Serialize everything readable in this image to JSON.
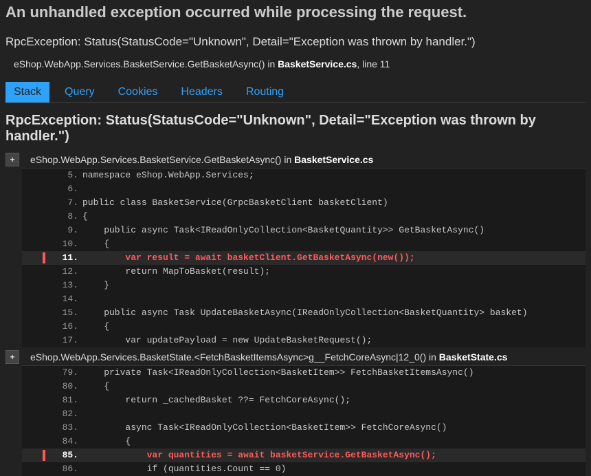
{
  "heading": "An unhandled exception occurred while processing the request.",
  "exception_summary": "RpcException: Status(StatusCode=\"Unknown\", Detail=\"Exception was thrown by handler.\")",
  "origin": {
    "prefix": "eShop.WebApp.Services.BasketService.GetBasketAsync() in ",
    "file": "BasketService.cs",
    "suffix": ", line 11"
  },
  "tabs": [
    {
      "label": "Stack",
      "active": true
    },
    {
      "label": "Query",
      "active": false
    },
    {
      "label": "Cookies",
      "active": false
    },
    {
      "label": "Headers",
      "active": false
    },
    {
      "label": "Routing",
      "active": false
    }
  ],
  "stack_heading": "RpcException: Status(StatusCode=\"Unknown\", Detail=\"Exception was thrown by handler.\")",
  "frames": [
    {
      "expand": "+",
      "prefix": "eShop.WebApp.Services.BasketService.GetBasketAsync() in ",
      "file": "BasketService.cs",
      "suffix": "",
      "lines": [
        {
          "n": "5",
          "hl": false,
          "code": "namespace eShop.WebApp.Services;"
        },
        {
          "n": "6",
          "hl": false,
          "code": ""
        },
        {
          "n": "7",
          "hl": false,
          "code": "public class BasketService(GrpcBasketClient basketClient)"
        },
        {
          "n": "8",
          "hl": false,
          "code": "{"
        },
        {
          "n": "9",
          "hl": false,
          "code": "    public async Task<IReadOnlyCollection<BasketQuantity>> GetBasketAsync()"
        },
        {
          "n": "10",
          "hl": false,
          "code": "    {"
        },
        {
          "n": "11",
          "hl": true,
          "code": "        var result = await basketClient.GetBasketAsync(new());"
        },
        {
          "n": "12",
          "hl": false,
          "code": "        return MapToBasket(result);"
        },
        {
          "n": "13",
          "hl": false,
          "code": "    }"
        },
        {
          "n": "14",
          "hl": false,
          "code": ""
        },
        {
          "n": "15",
          "hl": false,
          "code": "    public async Task UpdateBasketAsync(IReadOnlyCollection<BasketQuantity> basket)"
        },
        {
          "n": "16",
          "hl": false,
          "code": "    {"
        },
        {
          "n": "17",
          "hl": false,
          "code": "        var updatePayload = new UpdateBasketRequest();"
        }
      ]
    },
    {
      "expand": "+",
      "prefix": "eShop.WebApp.Services.BasketState.<FetchBasketItemsAsync>g__FetchCoreAsync|12_0() in ",
      "file": "BasketState.cs",
      "suffix": "",
      "lines": [
        {
          "n": "79",
          "hl": false,
          "code": "    private Task<IReadOnlyCollection<BasketItem>> FetchBasketItemsAsync()"
        },
        {
          "n": "80",
          "hl": false,
          "code": "    {"
        },
        {
          "n": "81",
          "hl": false,
          "code": "        return _cachedBasket ??= FetchCoreAsync();"
        },
        {
          "n": "82",
          "hl": false,
          "code": ""
        },
        {
          "n": "83",
          "hl": false,
          "code": "        async Task<IReadOnlyCollection<BasketItem>> FetchCoreAsync()"
        },
        {
          "n": "84",
          "hl": false,
          "code": "        {"
        },
        {
          "n": "85",
          "hl": true,
          "code": "            var quantities = await basketService.GetBasketAsync();"
        },
        {
          "n": "86",
          "hl": false,
          "code": "            if (quantities.Count == 0)"
        }
      ]
    }
  ]
}
